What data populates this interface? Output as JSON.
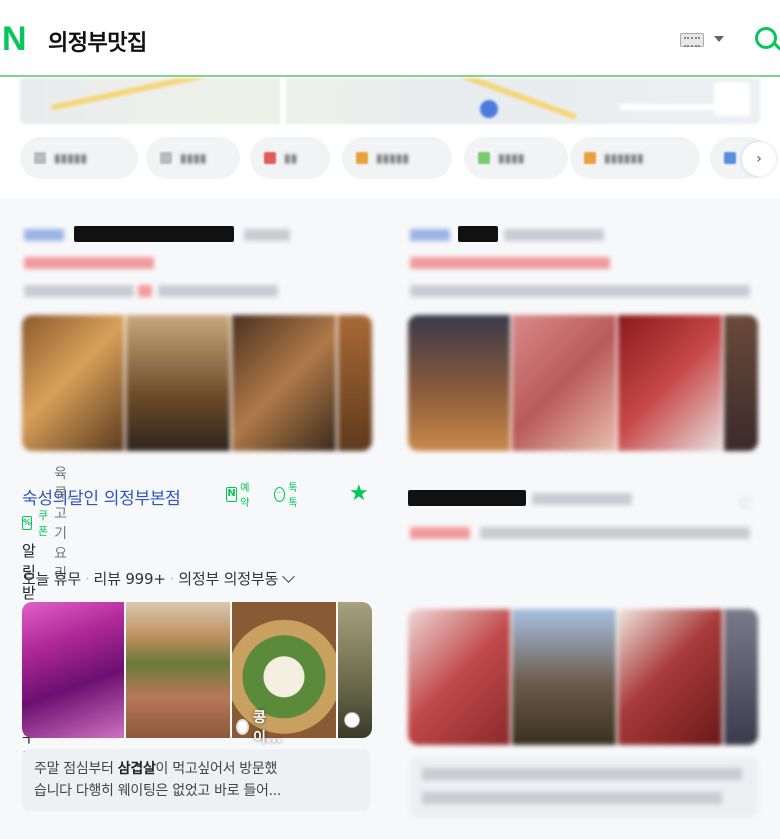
{
  "header": {
    "logo": "N",
    "query": "의정부맛집"
  },
  "featured": {
    "title": "숙성의달인 의정부본점",
    "reserve_label": "예약",
    "reserve_icon": "N",
    "talk_label": "톡톡",
    "coupon_label": "쿠폰",
    "category": "육류,고기요리",
    "promo": "알림받기 하면 5% 할인 쿠폰",
    "meta": {
      "status": "오늘 휴무",
      "reviews": "리뷰 999+",
      "location": "의정부 의정부동"
    },
    "photo_label": "콩이...",
    "review": {
      "prefix": "주말 점심부터 ",
      "highlight": "삼겹살",
      "suffix": "이 먹고싶어서 방문했",
      "line2": "습니다 다행히 웨이팅은 없었고 바로 들어..."
    }
  },
  "colors": {
    "naver_green": "#03c75a",
    "title_blue": "#2f54c6",
    "section_bg": "#f7f8fa"
  }
}
